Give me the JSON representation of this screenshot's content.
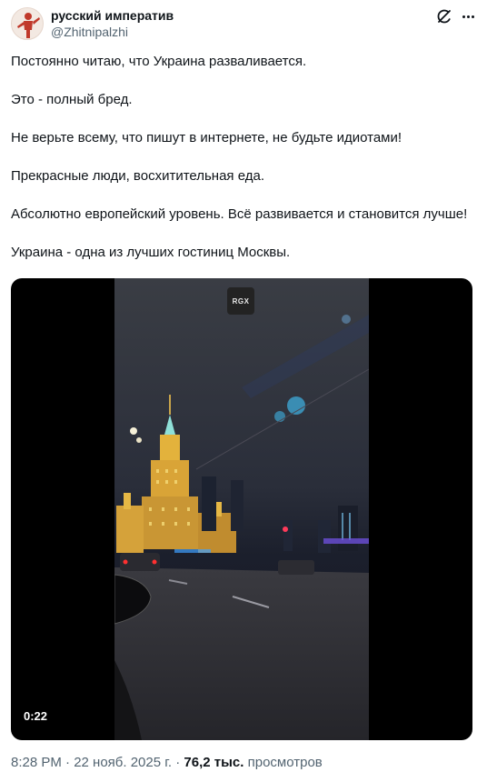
{
  "author": {
    "display_name": "русский императив",
    "handle": "@Zhitnipalzhi",
    "avatar_icon": "red-figure-avatar-icon"
  },
  "actions": {
    "grok_icon": "grok-icon",
    "more_icon": "more-dots-icon"
  },
  "tweet": {
    "lines": [
      "Постоянно читаю, что Украина разваливается.",
      "Это - полный бред.",
      "Не верьте всему, что пишут в интернете, не будьте идиотами!",
      "Прекрасные люди, восхитительная еда.",
      "Абсолютно европейский уровень. Всё развивается и становится лучше!",
      "Украина - одна из лучших гостиниц Москвы."
    ]
  },
  "media": {
    "watermark": "RGX",
    "duration": "0:22"
  },
  "meta": {
    "time": "8:28 PM · 22 нояб. 2025 г. ·",
    "views_count": "76,2 тыс.",
    "views_label": "просмотров"
  },
  "colors": {
    "text": "#0f1419",
    "secondary": "#536471",
    "avatar_figure": "#c0392b"
  }
}
